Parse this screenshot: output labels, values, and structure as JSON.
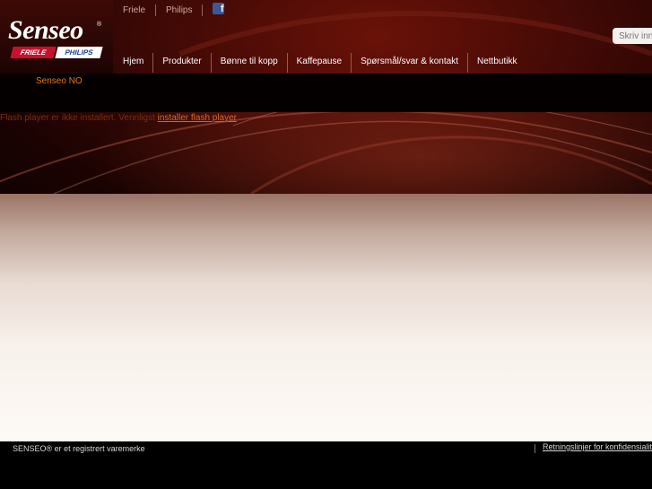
{
  "logo": {
    "wordmark": "Senseo",
    "registered_mark": "®",
    "friele_badge": "FRIELE",
    "philips_badge": "PHILIPS"
  },
  "top_links": {
    "friele": "Friele",
    "philips": "Philips",
    "facebook_glyph": "f"
  },
  "search": {
    "placeholder": "Skriv inn"
  },
  "nav": [
    {
      "label": "Hjem"
    },
    {
      "label": "Produkter"
    },
    {
      "label": "Bønne til kopp"
    },
    {
      "label": "Kaffepause"
    },
    {
      "label": "Spørsmål/svar & kontakt"
    },
    {
      "label": "Nettbutikk"
    }
  ],
  "breadcrumb": "Senseo NO",
  "flash_notice": {
    "text": "Flash player er ikke installert. Vennligst ",
    "link": "installer flash player"
  },
  "footer": {
    "copyright": "SENSEO® er et registrert varemerke",
    "privacy_link": "Retningslinjer for konfidensialitet"
  },
  "colors": {
    "brand_red": "#c8102e",
    "breadcrumb_orange": "#e2771f",
    "facebook_blue": "#3b5998"
  }
}
